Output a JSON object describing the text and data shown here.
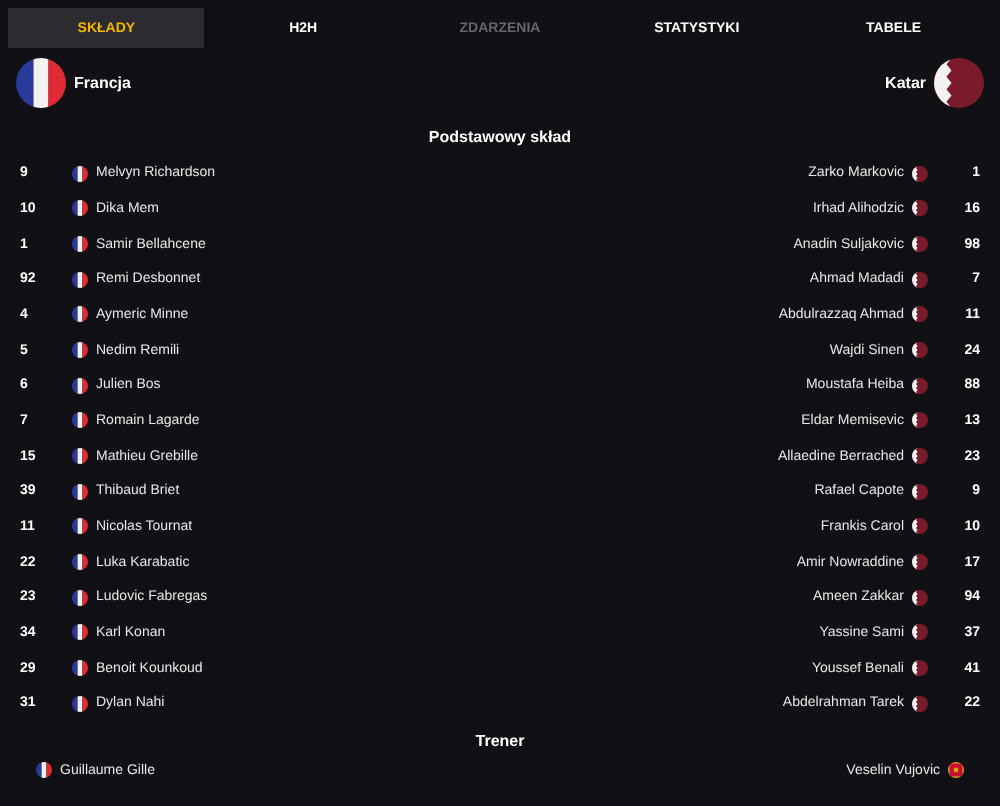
{
  "tabs": [
    {
      "label": "SKŁADY",
      "selected": true,
      "disabled": false
    },
    {
      "label": "H2H",
      "selected": false,
      "disabled": false
    },
    {
      "label": "ZDARZENIA",
      "selected": false,
      "disabled": true
    },
    {
      "label": "STATYSTYKI",
      "selected": false,
      "disabled": false
    },
    {
      "label": "TABELE",
      "selected": false,
      "disabled": false
    }
  ],
  "teams": {
    "home": "Francja",
    "away": "Katar"
  },
  "lineup": {
    "title": "Podstawowy skład",
    "home": [
      {
        "number": "9",
        "name": "Melvyn Richardson"
      },
      {
        "number": "10",
        "name": "Dika Mem"
      },
      {
        "number": "1",
        "name": "Samir Bellahcene"
      },
      {
        "number": "92",
        "name": "Remi Desbonnet"
      },
      {
        "number": "4",
        "name": "Aymeric Minne"
      },
      {
        "number": "5",
        "name": "Nedim Remili"
      },
      {
        "number": "6",
        "name": "Julien Bos"
      },
      {
        "number": "7",
        "name": "Romain Lagarde"
      },
      {
        "number": "15",
        "name": "Mathieu Grebille"
      },
      {
        "number": "39",
        "name": "Thibaud Briet"
      },
      {
        "number": "11",
        "name": "Nicolas Tournat"
      },
      {
        "number": "22",
        "name": "Luka Karabatic"
      },
      {
        "number": "23",
        "name": "Ludovic Fabregas"
      },
      {
        "number": "34",
        "name": "Karl Konan"
      },
      {
        "number": "29",
        "name": "Benoit Kounkoud"
      },
      {
        "number": "31",
        "name": "Dylan Nahi"
      }
    ],
    "away": [
      {
        "number": "1",
        "name": "Zarko Markovic"
      },
      {
        "number": "16",
        "name": "Irhad Alihodzic"
      },
      {
        "number": "98",
        "name": "Anadin Suljakovic"
      },
      {
        "number": "7",
        "name": "Ahmad Madadi"
      },
      {
        "number": "11",
        "name": "Abdulrazzaq Ahmad"
      },
      {
        "number": "24",
        "name": "Wajdi Sinen"
      },
      {
        "number": "88",
        "name": "Moustafa Heiba"
      },
      {
        "number": "13",
        "name": "Eldar Memisevic"
      },
      {
        "number": "23",
        "name": "Allaedine Berrached"
      },
      {
        "number": "9",
        "name": "Rafael Capote"
      },
      {
        "number": "10",
        "name": "Frankis Carol"
      },
      {
        "number": "17",
        "name": "Amir Nowraddine"
      },
      {
        "number": "94",
        "name": "Ameen Zakkar"
      },
      {
        "number": "37",
        "name": "Yassine Sami"
      },
      {
        "number": "41",
        "name": "Youssef Benali"
      },
      {
        "number": "22",
        "name": "Abdelrahman Tarek"
      }
    ]
  },
  "coaches": {
    "title": "Trener",
    "home": "Guillaume Gille",
    "away": "Veselin Vujovic"
  }
}
